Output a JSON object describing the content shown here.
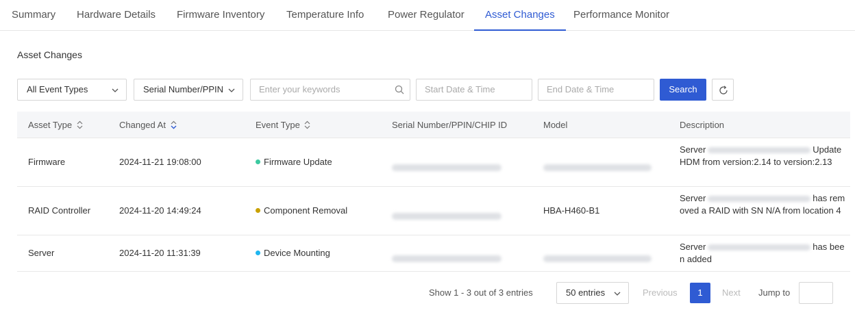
{
  "tabs": [
    {
      "label": "Summary"
    },
    {
      "label": "Hardware Details"
    },
    {
      "label": "Firmware Inventory"
    },
    {
      "label": "Temperature Info"
    },
    {
      "label": "Power Regulator"
    },
    {
      "label": "Asset Changes",
      "active": true
    },
    {
      "label": "Performance Monitor"
    }
  ],
  "section_title": "Asset Changes",
  "filters": {
    "event_type": "All Event Types",
    "id_type": "Serial Number/PPIN",
    "keyword_placeholder": "Enter your keywords",
    "start_placeholder": "Start Date & Time",
    "end_placeholder": "End Date & Time",
    "search_label": "Search"
  },
  "table": {
    "headers": {
      "asset_type": "Asset Type",
      "changed_at": "Changed At",
      "event_type": "Event Type",
      "serial": "Serial Number/PPIN/CHIP ID",
      "model": "Model",
      "description": "Description"
    },
    "rows": [
      {
        "asset_type": "Firmware",
        "changed_at": "2024-11-21 19:08:00",
        "event_type": "Firmware Update",
        "event_color": "#3cc9a0",
        "model": "",
        "desc_prefix": "Server",
        "desc_suffix": "Update HDM from version:2.14 to version:2.13"
      },
      {
        "asset_type": "RAID Controller",
        "changed_at": "2024-11-20 14:49:24",
        "event_type": "Component Removal",
        "event_color": "#c9a100",
        "model": "HBA-H460-B1",
        "desc_prefix": "Server",
        "desc_suffix": "has removed a RAID with SN N/A from location 4"
      },
      {
        "asset_type": "Server",
        "changed_at": "2024-11-20 11:31:39",
        "event_type": "Device Mounting",
        "event_color": "#1fb6f0",
        "model": "",
        "desc_prefix": "Server",
        "desc_suffix": "has been added"
      }
    ]
  },
  "pagination": {
    "summary": "Show 1 - 3 out of 3 entries",
    "page_size": "50 entries",
    "previous": "Previous",
    "current_page": "1",
    "next": "Next",
    "jump_to": "Jump to"
  },
  "colors": {
    "accent": "#2f5bd3",
    "header_bg": "#f5f6f8"
  }
}
